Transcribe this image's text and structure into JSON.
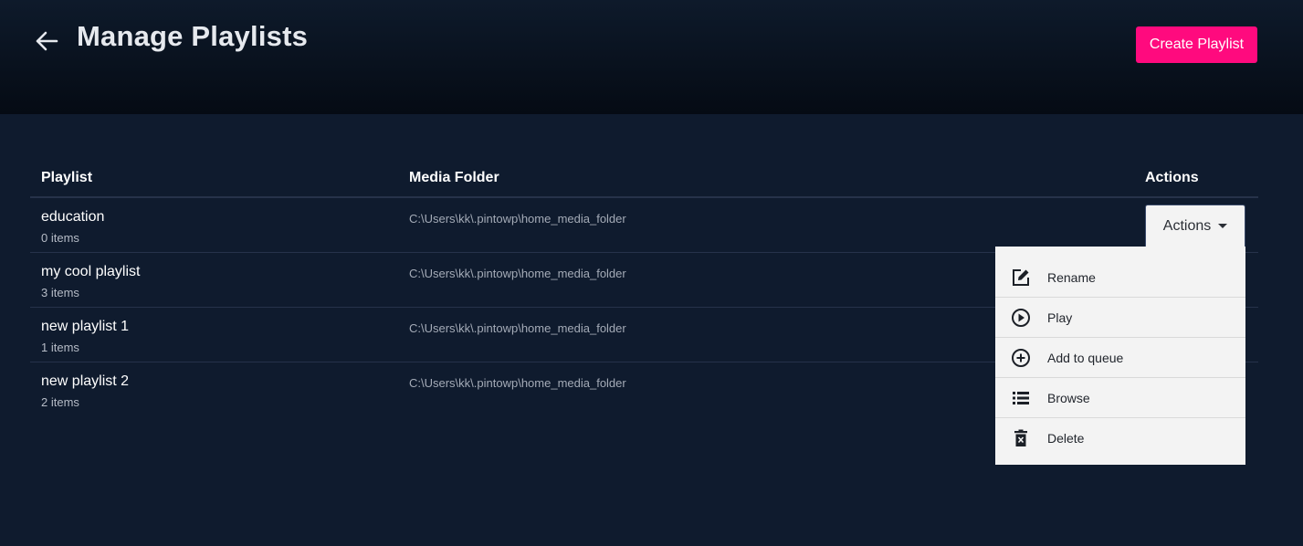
{
  "header": {
    "title": "Manage Playlists",
    "back_icon": "arrow-left-icon",
    "create_label": "Create Playlist",
    "create_color": "#ff0a7e"
  },
  "table": {
    "columns": [
      "Playlist",
      "Media Folder",
      "Actions"
    ],
    "rows": [
      {
        "name": "education",
        "count": "0 items",
        "folder": "C:\\Users\\kk\\.pintowp\\home_media_folder"
      },
      {
        "name": "my cool playlist",
        "count": "3 items",
        "folder": "C:\\Users\\kk\\.pintowp\\home_media_folder"
      },
      {
        "name": "new playlist 1",
        "count": "1 items",
        "folder": "C:\\Users\\kk\\.pintowp\\home_media_folder"
      },
      {
        "name": "new playlist 2",
        "count": "2 items",
        "folder": "C:\\Users\\kk\\.pintowp\\home_media_folder"
      }
    ]
  },
  "actions_dropdown": {
    "label": "Actions",
    "items": [
      {
        "label": "Rename",
        "icon": "edit-icon"
      },
      {
        "label": "Play",
        "icon": "play-circle-icon"
      },
      {
        "label": "Add to queue",
        "icon": "add-circle-icon"
      },
      {
        "label": "Browse",
        "icon": "list-icon"
      },
      {
        "label": "Delete",
        "icon": "trash-icon"
      }
    ]
  }
}
